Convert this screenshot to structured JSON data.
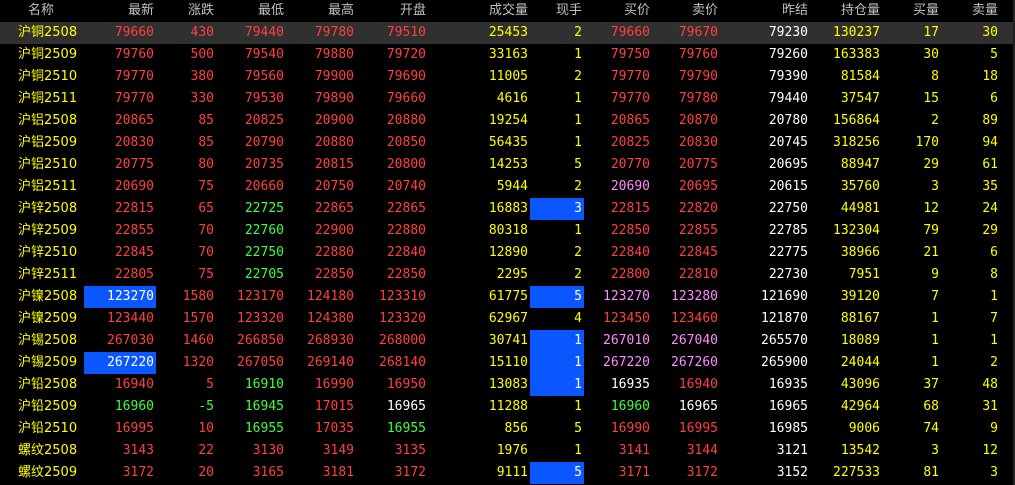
{
  "colors": {
    "up": "#ff4040",
    "down": "#40ff40",
    "flat": "#ffffff",
    "volume": "#ffff00",
    "highlight": "#0a57ff",
    "header": "#c0c0c0",
    "name": "#ffff00",
    "mine": "#ff8cff"
  },
  "headers": [
    "名称",
    "最新",
    "涨跌",
    "最低",
    "最高",
    "开盘",
    "成交量",
    "现手",
    "买价",
    "卖价",
    "昨结",
    "持仓量",
    "买量",
    "卖量"
  ],
  "rows": [
    {
      "name": "沪铜2508",
      "last": "79660",
      "chg": "430",
      "low": "79440",
      "high": "79780",
      "open": "79510",
      "vol": "25453",
      "cur": "2",
      "bid": "79660",
      "ask": "79670",
      "prev": "79230",
      "oi": "130237",
      "bidv": "17",
      "askv": "30"
    },
    {
      "name": "沪铜2509",
      "last": "79760",
      "chg": "500",
      "low": "79540",
      "high": "79880",
      "open": "79720",
      "vol": "33163",
      "cur": "1",
      "bid": "79750",
      "ask": "79760",
      "prev": "79260",
      "oi": "163383",
      "bidv": "30",
      "askv": "5"
    },
    {
      "name": "沪铜2510",
      "last": "79770",
      "chg": "380",
      "low": "79560",
      "high": "79900",
      "open": "79690",
      "vol": "11005",
      "cur": "2",
      "bid": "79770",
      "ask": "79790",
      "prev": "79390",
      "oi": "81584",
      "bidv": "8",
      "askv": "18"
    },
    {
      "name": "沪铜2511",
      "last": "79770",
      "chg": "330",
      "low": "79530",
      "high": "79890",
      "open": "79660",
      "vol": "4616",
      "cur": "1",
      "bid": "79770",
      "ask": "79780",
      "prev": "79440",
      "oi": "37547",
      "bidv": "15",
      "askv": "6"
    },
    {
      "name": "沪铝2508",
      "last": "20865",
      "chg": "85",
      "low": "20825",
      "high": "20900",
      "open": "20880",
      "vol": "19254",
      "cur": "1",
      "bid": "20865",
      "ask": "20870",
      "prev": "20780",
      "oi": "156864",
      "bidv": "2",
      "askv": "89"
    },
    {
      "name": "沪铝2509",
      "last": "20830",
      "chg": "85",
      "low": "20790",
      "high": "20880",
      "open": "20850",
      "vol": "56435",
      "cur": "1",
      "bid": "20825",
      "ask": "20830",
      "prev": "20745",
      "oi": "318256",
      "bidv": "170",
      "askv": "94"
    },
    {
      "name": "沪铝2510",
      "last": "20775",
      "chg": "80",
      "low": "20735",
      "high": "20815",
      "open": "20800",
      "vol": "14253",
      "cur": "5",
      "bid": "20770",
      "ask": "20775",
      "prev": "20695",
      "oi": "88947",
      "bidv": "29",
      "askv": "61"
    },
    {
      "name": "沪铝2511",
      "last": "20690",
      "chg": "75",
      "low": "20660",
      "high": "20750",
      "open": "20740",
      "vol": "5944",
      "cur": "2",
      "bid": "20690",
      "ask": "20695",
      "prev": "20615",
      "oi": "35760",
      "bidv": "3",
      "askv": "35"
    },
    {
      "name": "沪锌2508",
      "last": "22815",
      "chg": "65",
      "low": "22725",
      "high": "22865",
      "open": "22865",
      "vol": "16883",
      "cur": "3",
      "bid": "22815",
      "ask": "22820",
      "prev": "22750",
      "oi": "44981",
      "bidv": "12",
      "askv": "24"
    },
    {
      "name": "沪锌2509",
      "last": "22855",
      "chg": "70",
      "low": "22760",
      "high": "22900",
      "open": "22880",
      "vol": "80318",
      "cur": "1",
      "bid": "22850",
      "ask": "22855",
      "prev": "22785",
      "oi": "132304",
      "bidv": "79",
      "askv": "29"
    },
    {
      "name": "沪锌2510",
      "last": "22845",
      "chg": "70",
      "low": "22750",
      "high": "22880",
      "open": "22840",
      "vol": "12890",
      "cur": "2",
      "bid": "22840",
      "ask": "22845",
      "prev": "22775",
      "oi": "38966",
      "bidv": "21",
      "askv": "6"
    },
    {
      "name": "沪锌2511",
      "last": "22805",
      "chg": "75",
      "low": "22705",
      "high": "22850",
      "open": "22850",
      "vol": "2295",
      "cur": "2",
      "bid": "22800",
      "ask": "22810",
      "prev": "22730",
      "oi": "7951",
      "bidv": "9",
      "askv": "8"
    },
    {
      "name": "沪镍2508",
      "last": "123270",
      "chg": "1580",
      "low": "123170",
      "high": "124180",
      "open": "123310",
      "vol": "61775",
      "cur": "5",
      "bid": "123270",
      "ask": "123280",
      "prev": "121690",
      "oi": "39120",
      "bidv": "7",
      "askv": "1"
    },
    {
      "name": "沪镍2509",
      "last": "123440",
      "chg": "1570",
      "low": "123320",
      "high": "124380",
      "open": "123320",
      "vol": "62967",
      "cur": "4",
      "bid": "123450",
      "ask": "123460",
      "prev": "121870",
      "oi": "88167",
      "bidv": "1",
      "askv": "7"
    },
    {
      "name": "沪锡2508",
      "last": "267030",
      "chg": "1460",
      "low": "266850",
      "high": "268930",
      "open": "268000",
      "vol": "30741",
      "cur": "1",
      "bid": "267010",
      "ask": "267040",
      "prev": "265570",
      "oi": "18089",
      "bidv": "1",
      "askv": "1"
    },
    {
      "name": "沪锡2509",
      "last": "267220",
      "chg": "1320",
      "low": "267050",
      "high": "269140",
      "open": "268140",
      "vol": "15110",
      "cur": "1",
      "bid": "267220",
      "ask": "267260",
      "prev": "265900",
      "oi": "24044",
      "bidv": "1",
      "askv": "2"
    },
    {
      "name": "沪铅2508",
      "last": "16940",
      "chg": "5",
      "low": "16910",
      "high": "16990",
      "open": "16950",
      "vol": "13083",
      "cur": "1",
      "bid": "16935",
      "ask": "16940",
      "prev": "16935",
      "oi": "43096",
      "bidv": "37",
      "askv": "48"
    },
    {
      "name": "沪铅2509",
      "last": "16960",
      "chg": "-5",
      "low": "16945",
      "high": "17015",
      "open": "16965",
      "vol": "11288",
      "cur": "1",
      "bid": "16960",
      "ask": "16965",
      "prev": "16965",
      "oi": "42964",
      "bidv": "68",
      "askv": "31"
    },
    {
      "name": "沪铅2510",
      "last": "16995",
      "chg": "10",
      "low": "16955",
      "high": "17035",
      "open": "16955",
      "vol": "856",
      "cur": "5",
      "bid": "16990",
      "ask": "16995",
      "prev": "16985",
      "oi": "9006",
      "bidv": "74",
      "askv": "9"
    },
    {
      "name": "螺纹2508",
      "last": "3143",
      "chg": "22",
      "low": "3130",
      "high": "3149",
      "open": "3135",
      "vol": "1976",
      "cur": "1",
      "bid": "3141",
      "ask": "3144",
      "prev": "3121",
      "oi": "13542",
      "bidv": "3",
      "askv": "12"
    },
    {
      "name": "螺纹2509",
      "last": "3172",
      "chg": "20",
      "low": "3165",
      "high": "3181",
      "open": "3172",
      "vol": "9111",
      "cur": "5",
      "bid": "3171",
      "ask": "3172",
      "prev": "3152",
      "oi": "227533",
      "bidv": "81",
      "askv": "3"
    }
  ]
}
